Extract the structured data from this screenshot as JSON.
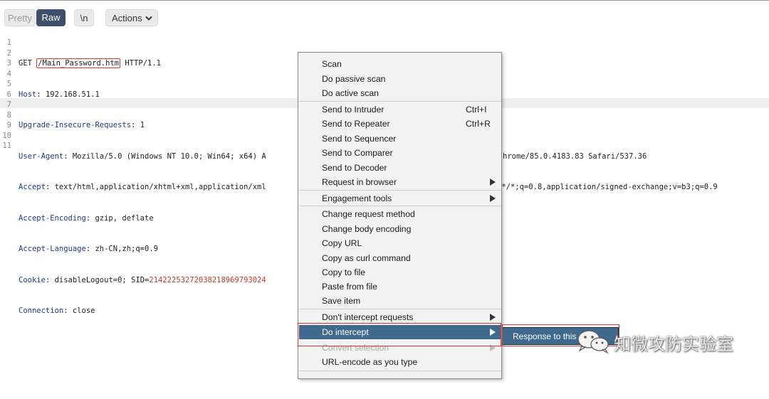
{
  "toolbar": {
    "pretty_label": "Pretty",
    "raw_label": "Raw",
    "newline_label": "\\n",
    "actions_label": "Actions"
  },
  "editor": {
    "line_numbers": [
      "1",
      "2",
      "3",
      "4",
      "5",
      "6",
      "7",
      "8",
      "9",
      "10",
      "11"
    ],
    "line1": {
      "method": "GET ",
      "path": "/Main_Password.htm",
      "protocol": " HTTP/1.1"
    },
    "line2": {
      "name": "Host",
      "value": ": 192.168.51.1"
    },
    "line3": {
      "name": "Upgrade-Insecure-Requests",
      "value": ": 1"
    },
    "line4": {
      "name": "User-Agent",
      "value": ": Mozilla/5.0 (Windows NT 10.0; Win64; x64) A",
      "tail": "hrome/85.0.4183.83 Safari/537.36"
    },
    "line5": {
      "name": "Accept",
      "value": ": text/html,application/xhtml+xml,application/xml",
      "tail": " */*;q=0.8,application/signed-exchange;v=b3;q=0.9"
    },
    "line6": {
      "name": "Accept-Encoding",
      "value": ": gzip, deflate"
    },
    "line7": {
      "name": "Accept-Language",
      "value": ": zh-CN,zh;q=0.9"
    },
    "line8": {
      "name": "Cookie",
      "value": ": disableLogout=0; SID=",
      "sid": "21422253272038218969793024"
    },
    "line9": {
      "name": "Connection",
      "value": ": close"
    }
  },
  "context_menu": {
    "scan": "Scan",
    "passive_scan": "Do passive scan",
    "active_scan": "Do active scan",
    "send_intruder": "Send to Intruder",
    "send_intruder_shortcut": "Ctrl+I",
    "send_repeater": "Send to Repeater",
    "send_repeater_shortcut": "Ctrl+R",
    "send_sequencer": "Send to Sequencer",
    "send_comparer": "Send to Comparer",
    "send_decoder": "Send to Decoder",
    "request_in_browser": "Request in browser",
    "engagement_tools": "Engagement tools",
    "change_method": "Change request method",
    "change_encoding": "Change body encoding",
    "copy_url": "Copy URL",
    "copy_curl": "Copy as curl command",
    "copy_to_file": "Copy to file",
    "paste_from_file": "Paste from file",
    "save_item": "Save item",
    "dont_intercept": "Don't intercept requests",
    "do_intercept": "Do intercept",
    "convert_selection": "Convert selection",
    "url_encode": "URL-encode as you type"
  },
  "submenu": {
    "response_to_this": "Response to this"
  },
  "watermark": {
    "text": "知微攻防实验室"
  },
  "colors": {
    "menu_selected": "#3f6a8e",
    "raw_button": "#3d4f6b",
    "highlight_box": "#d93b2b",
    "header_name": "#1f3b8a",
    "cookie_value": "#c23a2a"
  }
}
